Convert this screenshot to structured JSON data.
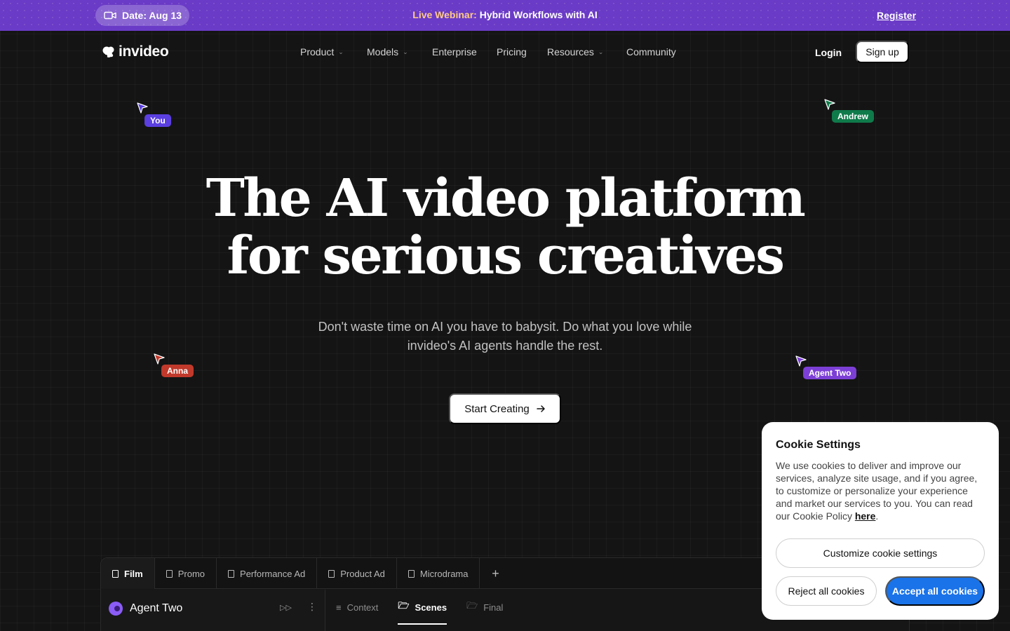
{
  "banner": {
    "date": "Date: Aug 13",
    "webinar_highlight": "Live Webinar:",
    "webinar_title": "Hybrid Workflows with AI",
    "register": "Register"
  },
  "brand": {
    "name": "invideo"
  },
  "nav": {
    "items": [
      {
        "label": "Product",
        "dropdown": true
      },
      {
        "label": "Models",
        "dropdown": true
      },
      {
        "label": "Enterprise",
        "dropdown": false
      },
      {
        "label": "Pricing",
        "dropdown": false
      },
      {
        "label": "Resources",
        "dropdown": true
      },
      {
        "label": "Community",
        "dropdown": false
      }
    ],
    "login": "Login",
    "signup": "Sign up"
  },
  "cursors": [
    {
      "name": "You",
      "color": "#5b3fe0"
    },
    {
      "name": "Andrew",
      "color": "#0f7a4a"
    },
    {
      "name": "Anna",
      "color": "#c0392b"
    },
    {
      "name": "Agent Two",
      "color": "#7c3fd6"
    }
  ],
  "hero": {
    "title_line1": "The AI video platform",
    "title_line2": "for serious creatives",
    "subtitle_line1": "Don't waste time on AI you have to babysit. Do what you love while",
    "subtitle_line2": "invideo's AI agents handle the rest.",
    "cta": "Start Creating"
  },
  "preview": {
    "tabs": [
      "Film",
      "Promo",
      "Performance Ad",
      "Product Ad",
      "Microdrama"
    ],
    "active_tab": "Film",
    "add_tab": "+",
    "agent_name": "Agent Two",
    "subtabs": [
      "Context",
      "Scenes",
      "Final"
    ],
    "active_subtab": "Scenes"
  },
  "cookie": {
    "title": "Cookie Settings",
    "body": "We use cookies to deliver and improve our services, analyze site usage, and if you agree, to customize or personalize your experience and market our services to you. You can read our Cookie Policy ",
    "link": "here",
    "body_end": ".",
    "customize": "Customize cookie settings",
    "reject": "Reject all cookies",
    "accept": "Accept all cookies"
  },
  "colors": {
    "banner_bg": "#6a3bc6",
    "accent_blue": "#1a73e8",
    "page_bg": "#141414"
  }
}
